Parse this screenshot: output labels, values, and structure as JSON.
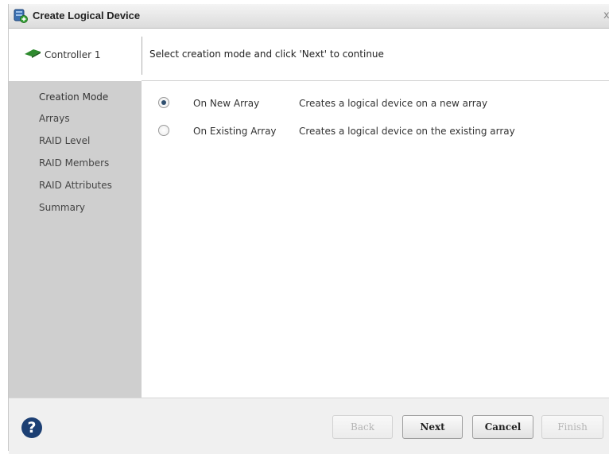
{
  "window": {
    "title": "Create Logical Device",
    "close_glyph": "x"
  },
  "header": {
    "controller_label": "Controller 1",
    "instruction": "Select creation mode and click 'Next' to continue"
  },
  "sidebar": {
    "items": [
      {
        "label": "Creation Mode",
        "active": true
      },
      {
        "label": "Arrays",
        "active": false
      },
      {
        "label": "RAID Level",
        "active": false
      },
      {
        "label": "RAID Members",
        "active": false
      },
      {
        "label": "RAID Attributes",
        "active": false
      },
      {
        "label": "Summary",
        "active": false
      }
    ]
  },
  "options": [
    {
      "label": "On New Array",
      "description": "Creates a logical device on a new array",
      "selected": true
    },
    {
      "label": "On Existing Array",
      "description": "Creates a logical device on the existing array",
      "selected": false
    }
  ],
  "footer": {
    "help_glyph": "?",
    "back_label": "Back",
    "next_label": "Next",
    "cancel_label": "Cancel",
    "finish_label": "Finish"
  },
  "colors": {
    "sidebar_bg": "#cfcfcf",
    "accent_green": "#2e8b2e",
    "help_blue": "#1c3f73"
  },
  "icons": {
    "title": "add-logical-device-icon",
    "controller": "controller-icon",
    "help": "help-icon"
  }
}
